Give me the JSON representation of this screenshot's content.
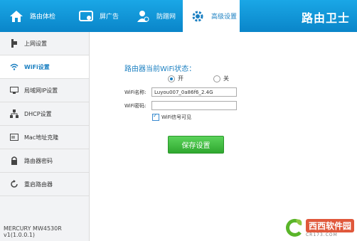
{
  "top_tabs": [
    {
      "label": "路由体检",
      "icon": "home-icon"
    },
    {
      "label": "屏广告",
      "icon": "block-ad-icon"
    },
    {
      "label": "防蹭网",
      "icon": "user-shield-icon"
    },
    {
      "label": "高级设置",
      "icon": "gear-icon"
    }
  ],
  "brand": "路由卫士",
  "sidebar": {
    "items": [
      {
        "label": "上网设置",
        "icon": "plug-icon"
      },
      {
        "label": "WiFi设置",
        "icon": "wifi-icon"
      },
      {
        "label": "局域网IP设置",
        "icon": "monitor-icon"
      },
      {
        "label": "DHCP设置",
        "icon": "dhcp-icon"
      },
      {
        "label": "Mac地址克隆",
        "icon": "card-icon"
      },
      {
        "label": "路由器密码",
        "icon": "lock-icon"
      },
      {
        "label": "重启路由器",
        "icon": "restart-icon"
      }
    ],
    "active_index": 1
  },
  "version": "MERCURY MW4530R v1(1.0.0.1)",
  "wifi": {
    "status_title": "路由器当前WiFi状态：",
    "on_label": "开",
    "off_label": "关",
    "name_label": "WiFi名称:",
    "name_value": "Luyou007_0a86f6_2.4G",
    "password_label": "WiFi密码:",
    "password_value": "",
    "visible_label": "WiFi信号可见",
    "save_label": "保存设置"
  },
  "watermark": {
    "main": "西西软件园",
    "sub": "CR173.COM"
  },
  "colors": {
    "accent": "#1a7fc1",
    "topbar": "#0f93d6",
    "save": "#3cb43c"
  }
}
